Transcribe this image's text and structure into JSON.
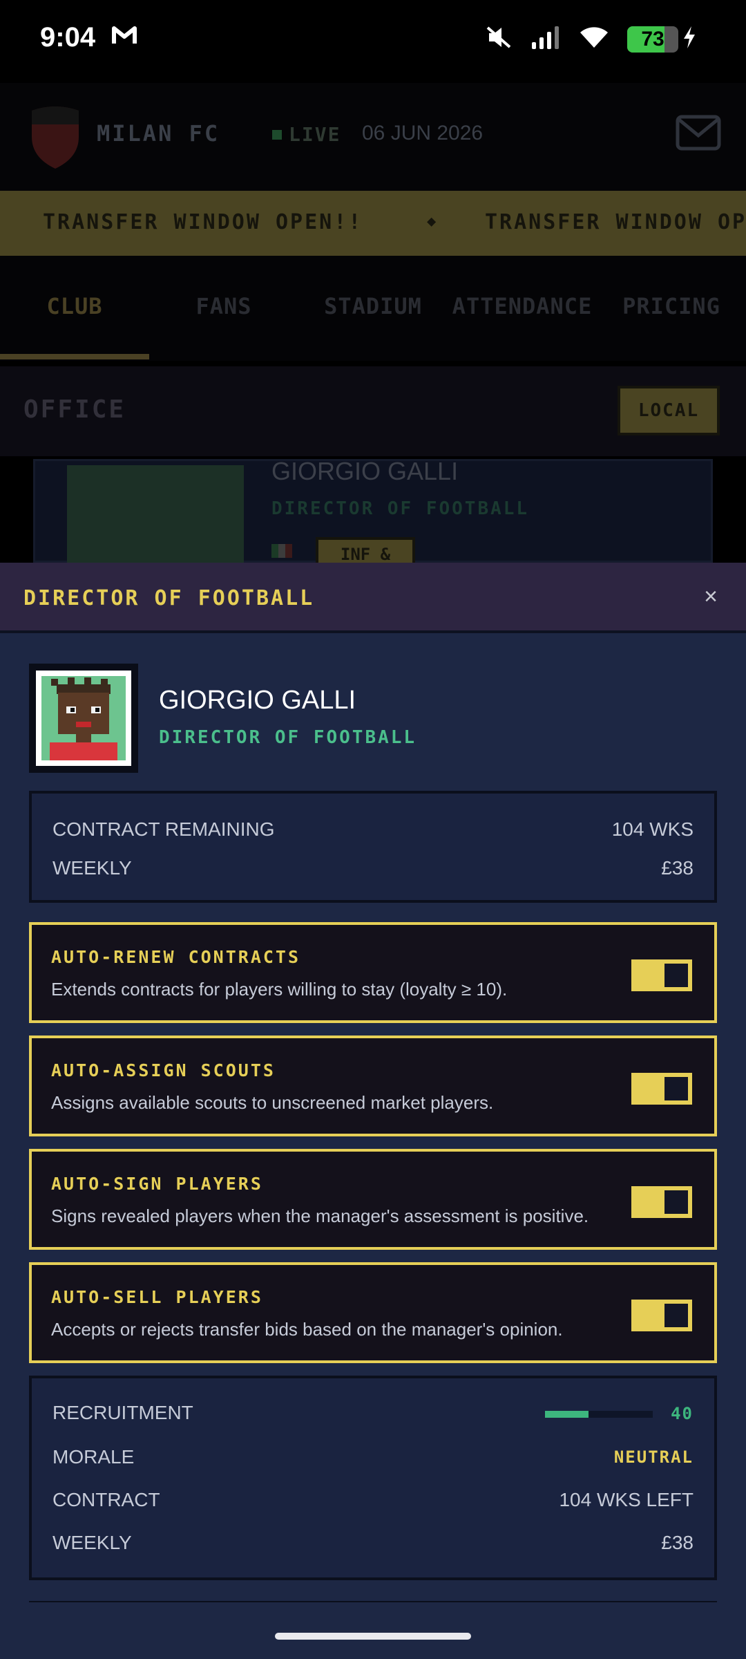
{
  "status_bar": {
    "time": "9:04",
    "carrier_icon": "M",
    "battery": "73"
  },
  "background": {
    "club_name": "MILAN FC",
    "live_label": "LIVE",
    "date": "06 JUN 2026",
    "ticker": [
      "TRANSFER WINDOW OPEN!!",
      "◆",
      "TRANSFER WINDOW OPEN!!"
    ],
    "tabs": [
      "CLUB",
      "FANS",
      "STADIUM",
      "ATTENDANCE",
      "PRICING"
    ],
    "active_tab": "CLUB",
    "section_title": "OFFICE",
    "local_button": "LOCAL",
    "card": {
      "name": "GIORGIO GALLI",
      "role": "DIRECTOR OF FOOTBALL",
      "tag": "INF &"
    }
  },
  "modal": {
    "title": "DIRECTOR OF FOOTBALL",
    "close": "×",
    "profile": {
      "name": "GIORGIO GALLI",
      "role": "DIRECTOR OF FOOTBALL"
    },
    "contract": [
      {
        "label": "CONTRACT REMAINING",
        "value": "104 WKS"
      },
      {
        "label": "WEEKLY",
        "value": "£38"
      }
    ],
    "options": [
      {
        "title": "AUTO-RENEW CONTRACTS",
        "desc": "Extends contracts for players willing to stay (loyalty ≥ 10).",
        "enabled": true
      },
      {
        "title": "AUTO-ASSIGN SCOUTS",
        "desc": "Assigns available scouts to unscreened market players.",
        "enabled": true
      },
      {
        "title": "AUTO-SIGN PLAYERS",
        "desc": "Signs revealed players when the manager's assessment is positive.",
        "enabled": true
      },
      {
        "title": "AUTO-SELL PLAYERS",
        "desc": "Accepts or rejects transfer bids based on the manager's opinion.",
        "enabled": true
      }
    ],
    "stats": {
      "recruitment_label": "RECRUITMENT",
      "recruitment_value": "40",
      "recruitment_level": 0.4,
      "morale_label": "MORALE",
      "morale_value": "NEUTRAL",
      "contract_label": "CONTRACT",
      "contract_value": "104 WKS LEFT",
      "weekly_label": "WEEKLY",
      "weekly_value": "£38"
    }
  },
  "colors": {
    "accent": "#e6cf57",
    "green": "#3db67e",
    "sheet_bg": "#1d2744"
  }
}
